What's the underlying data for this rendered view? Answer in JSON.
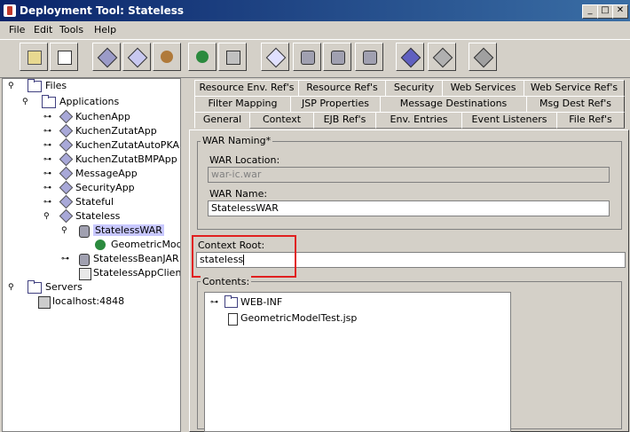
{
  "window": {
    "title": "Deployment Tool: Stateless"
  },
  "menu": [
    "File",
    "Edit",
    "Tools",
    "Help"
  ],
  "toolbar": {
    "buttons": [
      "open-icon",
      "save-icon",
      "new-application-icon",
      "new-war-icon",
      "new-bean-icon",
      "new-web-component-icon",
      "new-client-icon",
      "deploy-icon",
      "add-server-icon",
      "db-icon",
      "db-add-icon",
      "db-server-icon",
      "verify-icon",
      "undeploy-icon",
      "remove-icon"
    ]
  },
  "tree": {
    "files": "Files",
    "applications": "Applications",
    "apps": [
      "KuchenApp",
      "KuchenZutatApp",
      "KuchenZutatAutoPKAPP",
      "KuchenZutatBMPApp",
      "MessageApp",
      "SecurityApp",
      "Stateful",
      "Stateless"
    ],
    "stateless_children": [
      "StatelessWAR",
      "GeometricModel",
      "StatelessBeanJAR",
      "StatelessAppClient"
    ],
    "servers": "Servers",
    "localhost": "localhost:4848"
  },
  "tabs": {
    "row1": [
      "Resource Env. Ref's",
      "Resource Ref's",
      "Security",
      "Web Services",
      "Web Service Ref's"
    ],
    "row2": [
      "Filter Mapping",
      "JSP Properties",
      "Message Destinations",
      "Msg Dest Ref's"
    ],
    "row3": [
      "General",
      "Context",
      "EJB Ref's",
      "Env. Entries",
      "Event Listeners",
      "File Ref's"
    ]
  },
  "general": {
    "war_naming_label": "WAR Naming*",
    "war_location_label": "WAR Location:",
    "war_location_value": "war-ic.war",
    "war_name_label": "WAR Name:",
    "war_name_value": "StatelessWAR",
    "context_root_label": "Context Root:",
    "context_root_value": "stateless",
    "contents_label": "Contents:",
    "contents": [
      "WEB-INF",
      "GeometricModelTest.jsp"
    ]
  },
  "colors": {
    "highlight": "#e02020",
    "titlebar": "#0a246a"
  }
}
